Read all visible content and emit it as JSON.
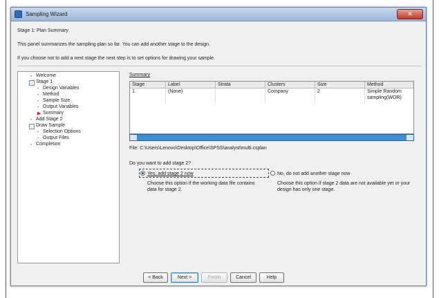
{
  "window": {
    "title": "Sampling Wizard",
    "close_glyph": "✕"
  },
  "header": {
    "stage_title": "Stage 1: Plan Summary",
    "description": "This panel summarizes the sampling plan so far. You can add another stage to the design.",
    "hint": "If you choose not to add a next stage the next step is to set options for drawing your sample."
  },
  "nav": {
    "items": [
      {
        "label": "Welcome",
        "kind": "leaf"
      },
      {
        "label": "Stage 1",
        "kind": "group"
      },
      {
        "label": "Design Variables",
        "kind": "child"
      },
      {
        "label": "Method",
        "kind": "child"
      },
      {
        "label": "Sample Size",
        "kind": "child"
      },
      {
        "label": "Output Variables",
        "kind": "child"
      },
      {
        "label": "Summary",
        "kind": "current"
      },
      {
        "label": "Add Stage 2",
        "kind": "leaf"
      },
      {
        "label": "Draw Sample",
        "kind": "group"
      },
      {
        "label": "Selection Options",
        "kind": "child"
      },
      {
        "label": "Output Files",
        "kind": "child"
      },
      {
        "label": "Completion",
        "kind": "leaf"
      }
    ]
  },
  "summary": {
    "label": "Summary",
    "columns": [
      "Stage",
      "Label",
      "Strata",
      "Clusters",
      "Size",
      "Method"
    ],
    "rows": [
      [
        "1",
        "(None)",
        "",
        "Company",
        "2",
        "Simple Random sampling(WOR)"
      ]
    ]
  },
  "file": {
    "label": "File:",
    "path": "C:\\Users\\Lenovo\\Desktop\\Office\\SPSS\\analyst\\multi.csplan"
  },
  "stage2": {
    "question": "Do you want to add stage 2?",
    "yes_label": "Yes, add stage 2 now",
    "yes_desc": "Choose this option if the working data file contains data for stage 2.",
    "no_label": "No, do not add another stage now",
    "no_desc": "Choose this option if stage 2 data are not available yet or your design has only one stage.",
    "selected": "yes"
  },
  "buttons": {
    "back": "< Back",
    "next": "Next >",
    "finish": "Finish",
    "cancel": "Cancel",
    "help": "Help"
  },
  "colors": {
    "accent": "#3c8fd6",
    "current_marker": "#c62828"
  }
}
